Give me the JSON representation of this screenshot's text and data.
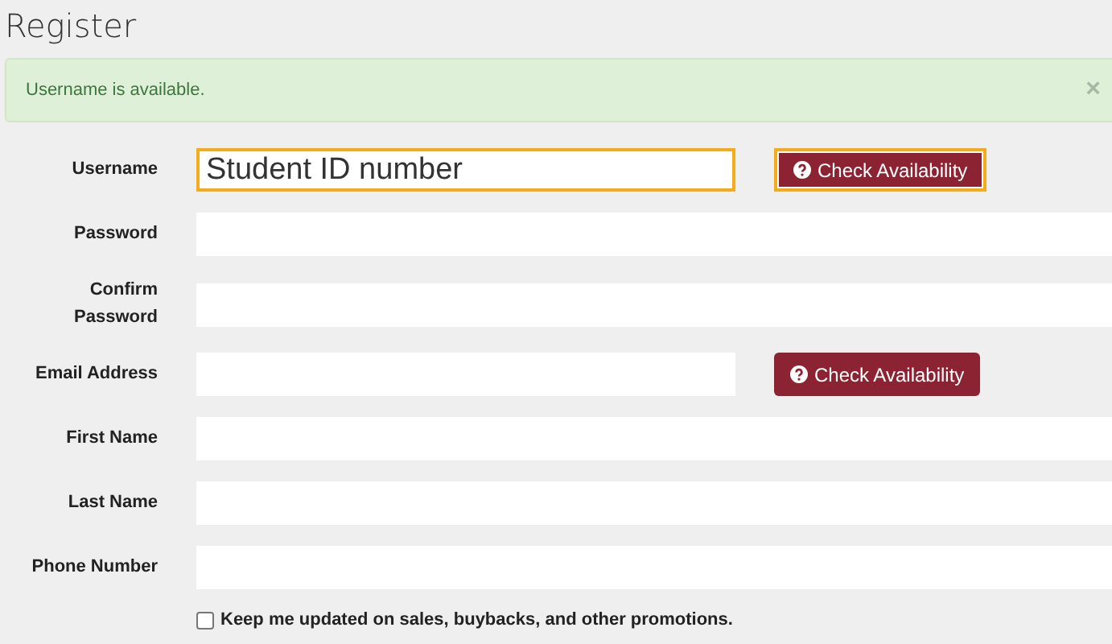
{
  "title": "Register",
  "alert": {
    "message": "Username is available.",
    "close": "×"
  },
  "fields": [
    {
      "label": "Username",
      "kind": "with-button",
      "value": "Student ID number",
      "highlighted": true,
      "button": {
        "label": "Check Availability",
        "highlighted": true
      }
    },
    {
      "label": "Password",
      "kind": "plain",
      "highlighted": false
    },
    {
      "label": "Confirm Password",
      "kind": "plain",
      "highlighted": false
    },
    {
      "label": "Email Address",
      "kind": "with-button",
      "highlighted": false,
      "button": {
        "label": "Check Availability",
        "highlighted": false
      }
    },
    {
      "label": "First Name",
      "kind": "plain",
      "highlighted": false
    },
    {
      "label": "Last Name",
      "kind": "plain",
      "highlighted": false
    },
    {
      "label": "Phone Number",
      "kind": "plain",
      "highlighted": false
    }
  ],
  "newsletter": {
    "label": "Keep me updated on sales, buybacks, and other promotions.",
    "checked": false
  }
}
